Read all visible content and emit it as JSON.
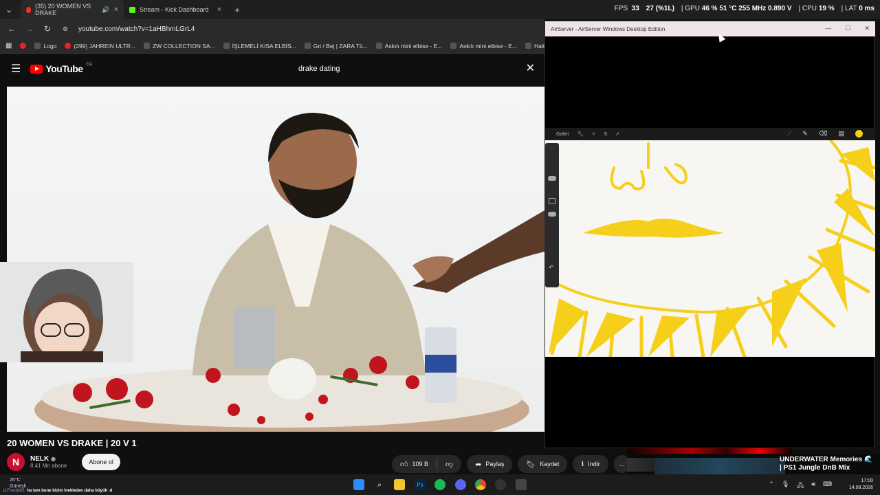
{
  "browser": {
    "tabs": [
      {
        "label": "(35) 20 WOMEN VS DRAKE",
        "active": true
      },
      {
        "label": "Stream - Kick Dashboard",
        "active": false
      }
    ],
    "url": "youtube.com/watch?v=1aHBhmLGrL4",
    "bookmarks": [
      "Logo",
      "(299) JAHREIN ULTR...",
      "ZW COLLECTION SA...",
      "İŞLEMELİ KISA ELBİS...",
      "Gri / Bej | ZARA Tü...",
      "Askılı mini elbise - E...",
      "Askılı mini elbise - E...",
      "Halter yaka mini"
    ]
  },
  "stats": {
    "fps_label": "FPS",
    "fps": "33",
    "fps_low": "27 (%1L)",
    "gpu_label": "GPU",
    "gpu": "46 % 51 °C 255 MHz 0.890 V",
    "cpu_label": "CPU",
    "cpu": "19 %",
    "lat_label": "LAT",
    "lat": "0 ms"
  },
  "youtube": {
    "logo": "YouTube",
    "country": "TR",
    "search_value": "drake dating",
    "video_title": "20 WOMEN VS DRAKE | 20 V 1",
    "channel_initial": "N",
    "channel_name": "NELK",
    "channel_subs": "8,41 Mn abone",
    "subscribe_label": "Abone ol",
    "likes": "109 B",
    "share_label": "Paylaş",
    "save_label": "Kaydet",
    "download_label": "İndir",
    "more_label": "..."
  },
  "airserver": {
    "title": "AirServer - AirServer Windows Desktop Edition",
    "gallery_label": "Galeri"
  },
  "music": {
    "title": "UNDERWATER Memories 🌊 | PS1 Jungle DnB Mix"
  },
  "taskbar": {
    "temp": "26°C",
    "weather": "Güneşli",
    "ticker_user": "11Freedo81:",
    "ticker_text": "ha tam bune bizim lnekleden daha büyük :d",
    "time": "17:00",
    "date": "14.08.2026"
  },
  "colors": {
    "yt_red": "#ff0000",
    "kick_green": "#53fc18",
    "procreate_yellow": "#f5cf1a"
  }
}
